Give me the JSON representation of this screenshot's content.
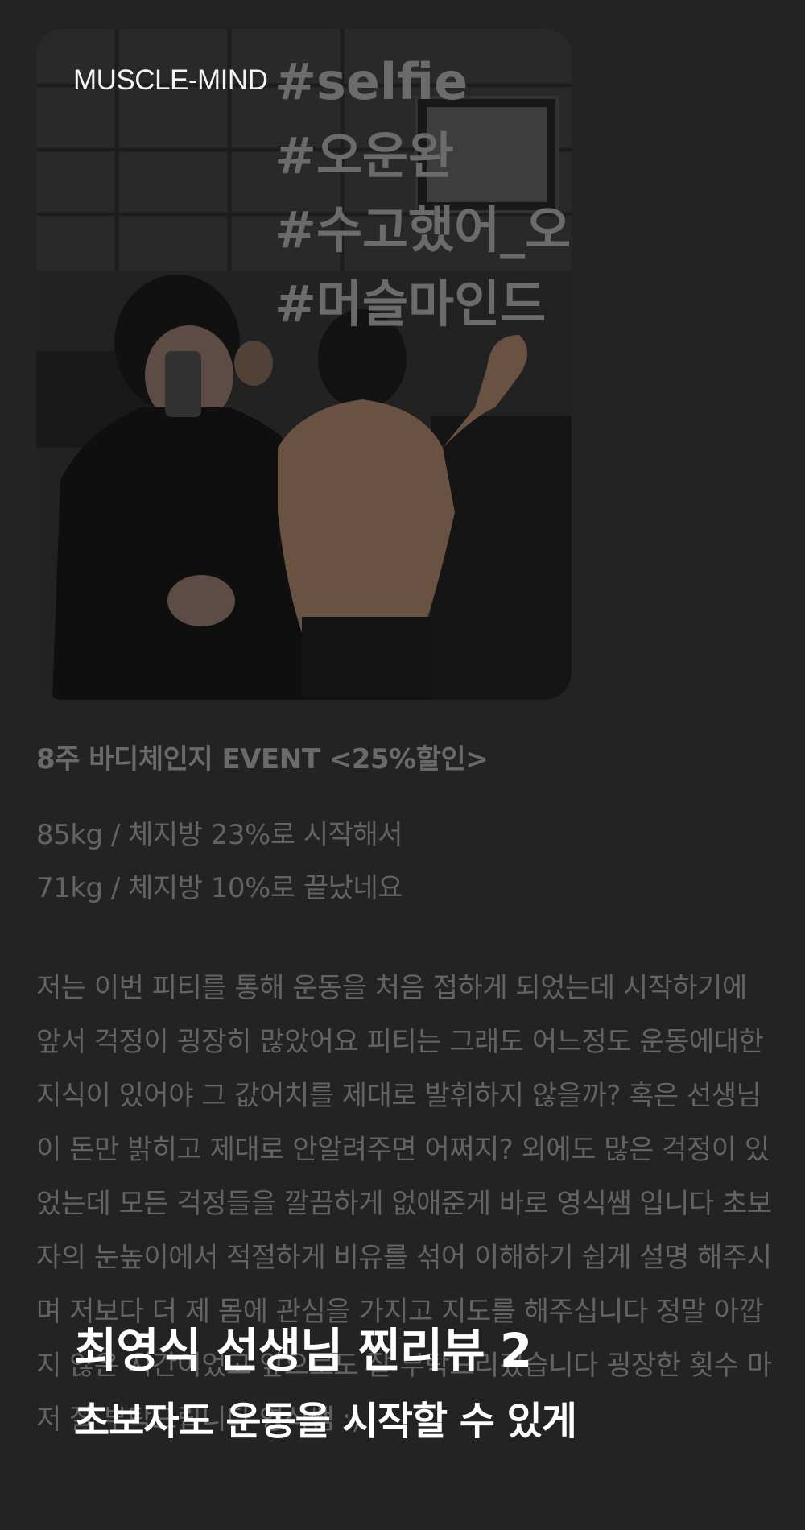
{
  "post": {
    "brand": "MUSCLE-MIND",
    "hashtags": [
      "#selfie",
      "#오운완",
      "#수고했어_오",
      "#머슬마인드"
    ],
    "event_title": "8주 바디체인지 EVENT <25%할인>",
    "stats": [
      "85kg / 체지방 23%로 시작해서",
      "71kg / 체지방 10%로 끝났네요"
    ],
    "review": "저는 이번 피티를 통해 운동을 처음 접하게 되었는데 시작하기에 앞서 걱정이 굉장히 많았어요 피티는 그래도 어느정도 운동에대한 지식이 있어야 그 값어치를 제대로 발휘하지 않을까? 혹은 선생님이 돈만 밝히고 제대로 안알려주면 어쩌지? 외에도 많은 걱정이 있었는데 모든 걱정들을 깔끔하게 없애준게 바로 영식쌤 입니다 초보자의 눈높이에서 적절하게 비유를 섞어 이해하기 쉽게 설명 해주시며 저보다 더 제 몸에 관심을 가지고 지도를 해주십니다 정말 아깝지 않은 시간이었고 앞으로도 잘 부탁드리겠습니다 굉장한 횟수 마저 잘 부탁드립니다 영식쌤 :)"
  },
  "overlay": {
    "title": "최영식 선생님 찐리뷰 2",
    "subtitle": "초보자도 운동을 시작할 수 있게"
  }
}
